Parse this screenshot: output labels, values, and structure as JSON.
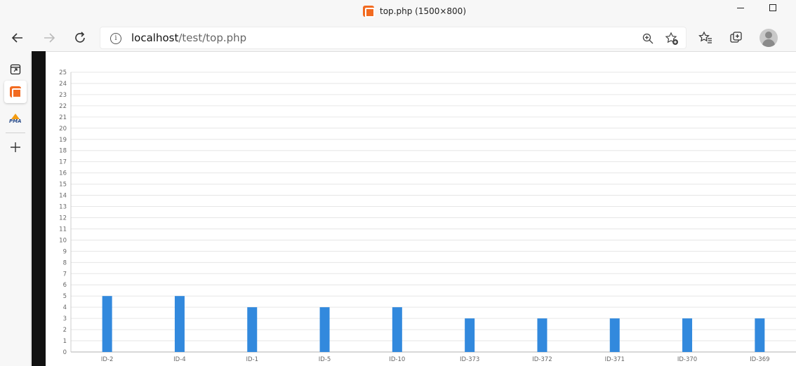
{
  "window": {
    "title": "top.php (1500×800)",
    "favicon": "xampp-icon"
  },
  "toolbar": {
    "url_host": "localhost",
    "url_path": "/test/top.php",
    "icons": [
      "back-icon",
      "forward-icon",
      "refresh-icon",
      "info-icon",
      "zoom-icon",
      "add-favorite-icon",
      "favorites-icon",
      "collections-icon",
      "profile-icon"
    ]
  },
  "sidebar": {
    "items": [
      "tab-actions-icon",
      "xampp-icon",
      "phpmyadmin-icon",
      "add-icon"
    ],
    "pma_text": "PMA"
  },
  "colors": {
    "bar": "#3289dd",
    "grid": "#e6e6e6",
    "axis": "#cccccc"
  },
  "chart_data": {
    "type": "bar",
    "categories": [
      "ID-2",
      "ID-4",
      "ID-1",
      "ID-5",
      "ID-10",
      "ID-373",
      "ID-372",
      "ID-371",
      "ID-370",
      "ID-369"
    ],
    "values": [
      5,
      5,
      4,
      4,
      4,
      3,
      3,
      3,
      3,
      3
    ],
    "title": "",
    "xlabel": "",
    "ylabel": "",
    "ylim": [
      0,
      25
    ],
    "yticks": [
      0,
      1,
      2,
      3,
      4,
      5,
      6,
      7,
      8,
      9,
      10,
      11,
      12,
      13,
      14,
      15,
      16,
      17,
      18,
      19,
      20,
      21,
      22,
      23,
      24,
      25
    ],
    "grid": true,
    "legend": "none"
  }
}
